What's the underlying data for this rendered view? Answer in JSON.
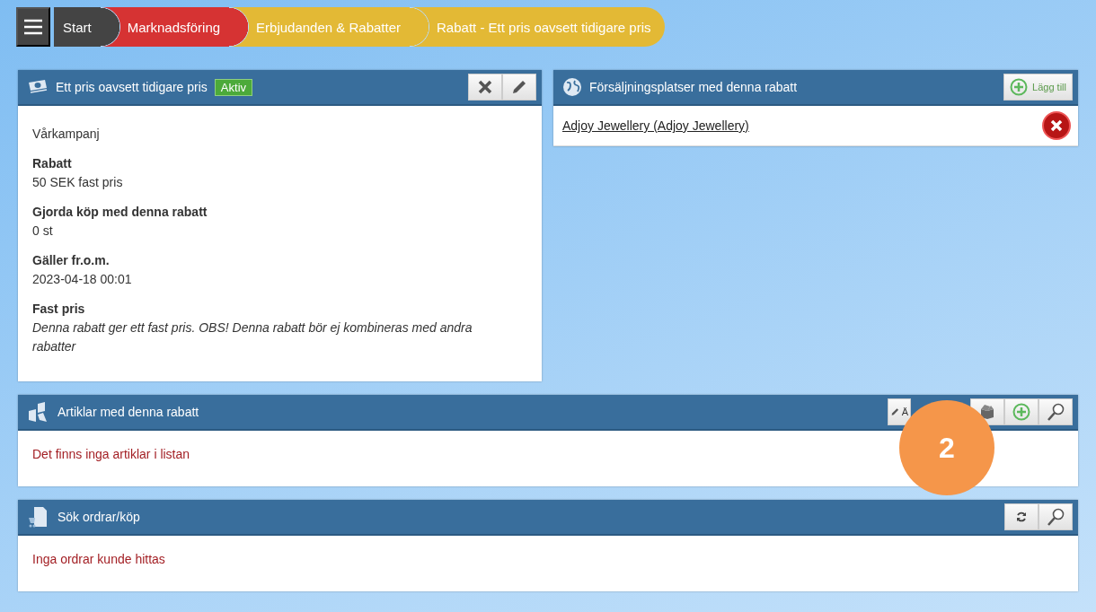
{
  "breadcrumbs": [
    {
      "label": "Start",
      "color": "#444444"
    },
    {
      "label": "Marknadsföring",
      "color": "#d63333"
    },
    {
      "label": "Erbjudanden & Rabatter",
      "color": "#e3b935"
    },
    {
      "label": "Rabatt - Ett pris oavsett tidigare pris",
      "color": "#e3b935"
    }
  ],
  "discount_panel": {
    "title": "Ett pris oavsett tidigare pris",
    "status": "Aktiv",
    "name": "Vårkampanj",
    "fields": [
      {
        "label": "Rabatt",
        "value": "50 SEK fast pris",
        "kind": "plain"
      },
      {
        "label": "Gjorda köp med denna rabatt",
        "value": "0 st",
        "kind": "plain"
      },
      {
        "label": "Gäller fr.o.m.",
        "value": "2023-04-18 00:01",
        "kind": "plain"
      },
      {
        "label": "Fast pris",
        "value": "Denna rabatt ger ett fast pris. OBS! Denna rabatt bör ej kombineras med andra rabatter",
        "kind": "note"
      }
    ]
  },
  "sales_panel": {
    "title": "Försäljningsplatser med denna rabatt",
    "add_button": "Lägg till",
    "items": [
      "Adjoy Jewellery (Adjoy Jewellery)"
    ]
  },
  "articles_panel": {
    "title": "Artiklar med denna rabatt",
    "edit_button": "Ä",
    "empty_message": "Det finns inga artiklar i listan"
  },
  "orders_panel": {
    "title": "Sök ordrar/köp",
    "empty_message": "Inga ordrar kunde hittas"
  },
  "badge": "2"
}
